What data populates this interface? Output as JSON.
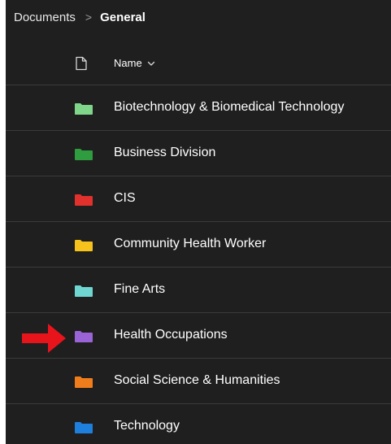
{
  "breadcrumb": {
    "root": "Documents",
    "separator": ">",
    "current": "General"
  },
  "header": {
    "name_label": "Name",
    "file_type_icon": "document-icon",
    "sort_icon": "chevron-down-icon"
  },
  "folders": [
    {
      "label": "Biotechnology & Biomedical Technology",
      "color": "#7fd68b"
    },
    {
      "label": "Business Division",
      "color": "#2e9c3f"
    },
    {
      "label": "CIS",
      "color": "#e0312c"
    },
    {
      "label": "Community Health Worker",
      "color": "#f6c21c"
    },
    {
      "label": "Fine Arts",
      "color": "#6fd6d2"
    },
    {
      "label": "Health Occupations",
      "color": "#9a63d6"
    },
    {
      "label": "Social Science & Humanities",
      "color": "#f07d1c"
    },
    {
      "label": "Technology",
      "color": "#1e7fdc"
    }
  ],
  "annotation": {
    "icon": "red-arrow-icon",
    "color": "#e8141c",
    "points_to": "Health Occupations"
  }
}
